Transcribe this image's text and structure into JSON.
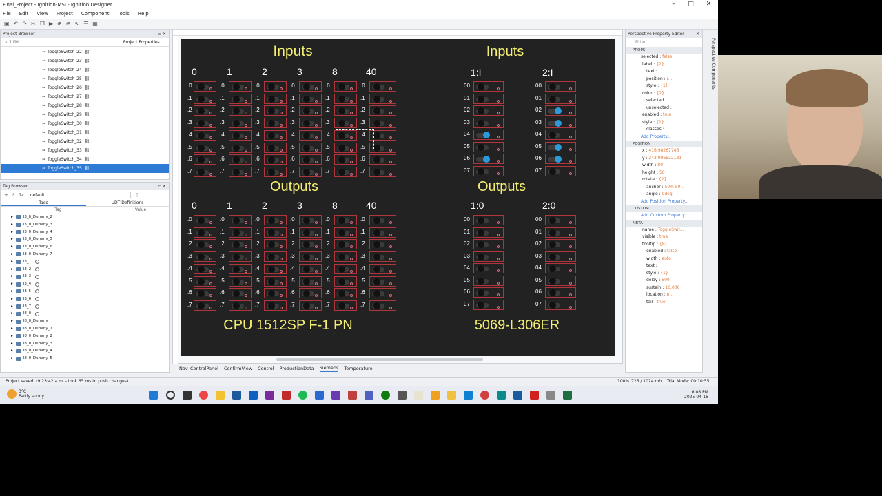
{
  "window": {
    "title": "Final_Project - Ignition-MSI - Ignition Designer",
    "controls": [
      "–",
      "□",
      "✕"
    ]
  },
  "menu": [
    "File",
    "Edit",
    "View",
    "Project",
    "Component",
    "Tools",
    "Help"
  ],
  "project_browser": {
    "title": "Project Browser",
    "filter_placeholder": "Filter",
    "props_tab": "Project Properties",
    "items": [
      "ToggleSwitch_22",
      "ToggleSwitch_23",
      "ToggleSwitch_24",
      "ToggleSwitch_25",
      "ToggleSwitch_26",
      "ToggleSwitch_27",
      "ToggleSwitch_28",
      "ToggleSwitch_29",
      "ToggleSwitch_30",
      "ToggleSwitch_31",
      "ToggleSwitch_32",
      "ToggleSwitch_33",
      "ToggleSwitch_34",
      "ToggleSwitch_35"
    ]
  },
  "tag_browser": {
    "title": "Tag Browser",
    "provider": "default",
    "tabs": [
      "Tags",
      "UDT Definitions"
    ],
    "col_tag": "Tag",
    "col_value": "Value",
    "rows": [
      "I3_0_Dummy_2",
      "I3_0_Dummy_3",
      "I3_0_Dummy_4",
      "I3_0_Dummy_5",
      "I3_0_Dummy_6",
      "I3_0_Dummy_7",
      "I3_1",
      "I3_2",
      "I3_3",
      "I3_4",
      "I3_5",
      "I3_6",
      "I3_7",
      "I8_0",
      "I8_0_Dummy",
      "I8_0_Dummy_1",
      "I8_0_Dummy_2",
      "I8_0_Dummy_3",
      "I8_0_Dummy_4",
      "I8_0_Dummy_5"
    ]
  },
  "canvas": {
    "left_inputs_title": "Inputs",
    "left_outputs_title": "Outputs",
    "right_inputs_title": "Inputs",
    "right_outputs_title": "Outputs",
    "left_columns": [
      "0",
      "1",
      "2",
      "3",
      "8",
      "40"
    ],
    "row_labels": [
      ".0",
      ".1",
      ".2",
      ".3",
      ".4",
      ".5",
      ".6",
      ".7"
    ],
    "right_in_columns": [
      "1:I",
      "2:I"
    ],
    "right_out_columns": [
      "1:0",
      "2:0"
    ],
    "right_row_labels": [
      "00",
      "01",
      "02",
      "03",
      "04",
      "05",
      "06",
      "07"
    ],
    "cpu_label": "CPU 1512SP F-1 PN",
    "module_label": "5069-L306ER",
    "in1_on": [
      4,
      6
    ],
    "in2_on": [
      2,
      3,
      5,
      6
    ]
  },
  "property_editor": {
    "title": "Perspective Property Editor",
    "filter_placeholder": "Filter",
    "side_tab": "Perspective Components",
    "props_header": "PROPS",
    "position_header": "POSITION",
    "custom_header": "CUSTOM",
    "meta_header": "META",
    "rows_props": [
      [
        "selected",
        "false"
      ],
      [
        "label",
        "{2}"
      ],
      [
        "text",
        ""
      ],
      [
        "position",
        "r..."
      ],
      [
        "style",
        "{1}"
      ],
      [
        "color",
        "{2}"
      ],
      [
        "selected",
        ""
      ],
      [
        "unselected",
        ""
      ],
      [
        "enabled",
        "true"
      ],
      [
        "style",
        "{1}"
      ],
      [
        "classes",
        ""
      ]
    ],
    "add_property": "Add Property...",
    "rows_position": [
      [
        "x",
        "416.98267746"
      ],
      [
        "y",
        "243.986522131"
      ],
      [
        "width",
        "80"
      ],
      [
        "height",
        "56"
      ],
      [
        "rotate",
        "{2}"
      ],
      [
        "anchor",
        "50% 50..."
      ],
      [
        "angle",
        "0deg"
      ]
    ],
    "add_position": "Add Position Property...",
    "add_custom": "Add Custom Property...",
    "rows_meta": [
      [
        "name",
        "ToggleSwit..."
      ],
      [
        "visible",
        "true"
      ],
      [
        "tooltip",
        "{8}"
      ],
      [
        "enabled",
        "false"
      ],
      [
        "width",
        "auto"
      ],
      [
        "text",
        ""
      ],
      [
        "style",
        "{1}"
      ],
      [
        "delay",
        "500"
      ],
      [
        "sustain",
        "10,000"
      ],
      [
        "location",
        "n..."
      ],
      [
        "tail",
        "true"
      ]
    ]
  },
  "view_tabs": [
    "Nav_ControlPanel",
    "ConfirmView",
    "Control",
    "ProductionData",
    "Siemens",
    "Temperature"
  ],
  "status": {
    "left": "Project saved. (9:23:42 a.m. - took 65 ms to push changes)",
    "zoom": "100%",
    "memory": "726 / 1024 mb",
    "trial": "Trial Mode: 00:10:55"
  },
  "taskbar": {
    "weather_temp": "3°C",
    "weather_desc": "Partly sunny",
    "time": "6:08 PM",
    "date": "2025-04-16"
  },
  "colors": {
    "canvas_bg": "#222222",
    "title_yellow": "#f4ef72",
    "border_red": "#b0353d",
    "toggle_on": "#2a9ad9",
    "selection": "#2e7bd6"
  }
}
